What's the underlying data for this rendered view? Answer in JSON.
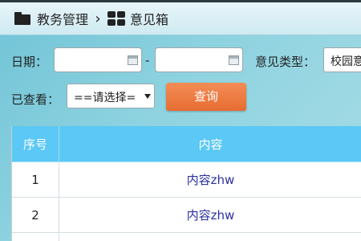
{
  "breadcrumb": {
    "section": "教务管理",
    "page": "意见箱"
  },
  "filters": {
    "date_label": "日期：",
    "date_start_value": "",
    "date_separator": "-",
    "date_end_value": "",
    "type_label": "意见类型：",
    "type_selected": "校园意",
    "viewed_label": "已查看：",
    "viewed_selected": "==请选择="
  },
  "actions": {
    "query_label": "查询"
  },
  "table": {
    "headers": [
      "序号",
      "内容"
    ],
    "rows": [
      {
        "no": "1",
        "content": "内容zhw"
      },
      {
        "no": "2",
        "content": "内容zhw"
      }
    ]
  },
  "colors": {
    "header_accent": "#5bc8f5",
    "query_button": "#e66d33",
    "link_text": "#2a2f9e"
  }
}
